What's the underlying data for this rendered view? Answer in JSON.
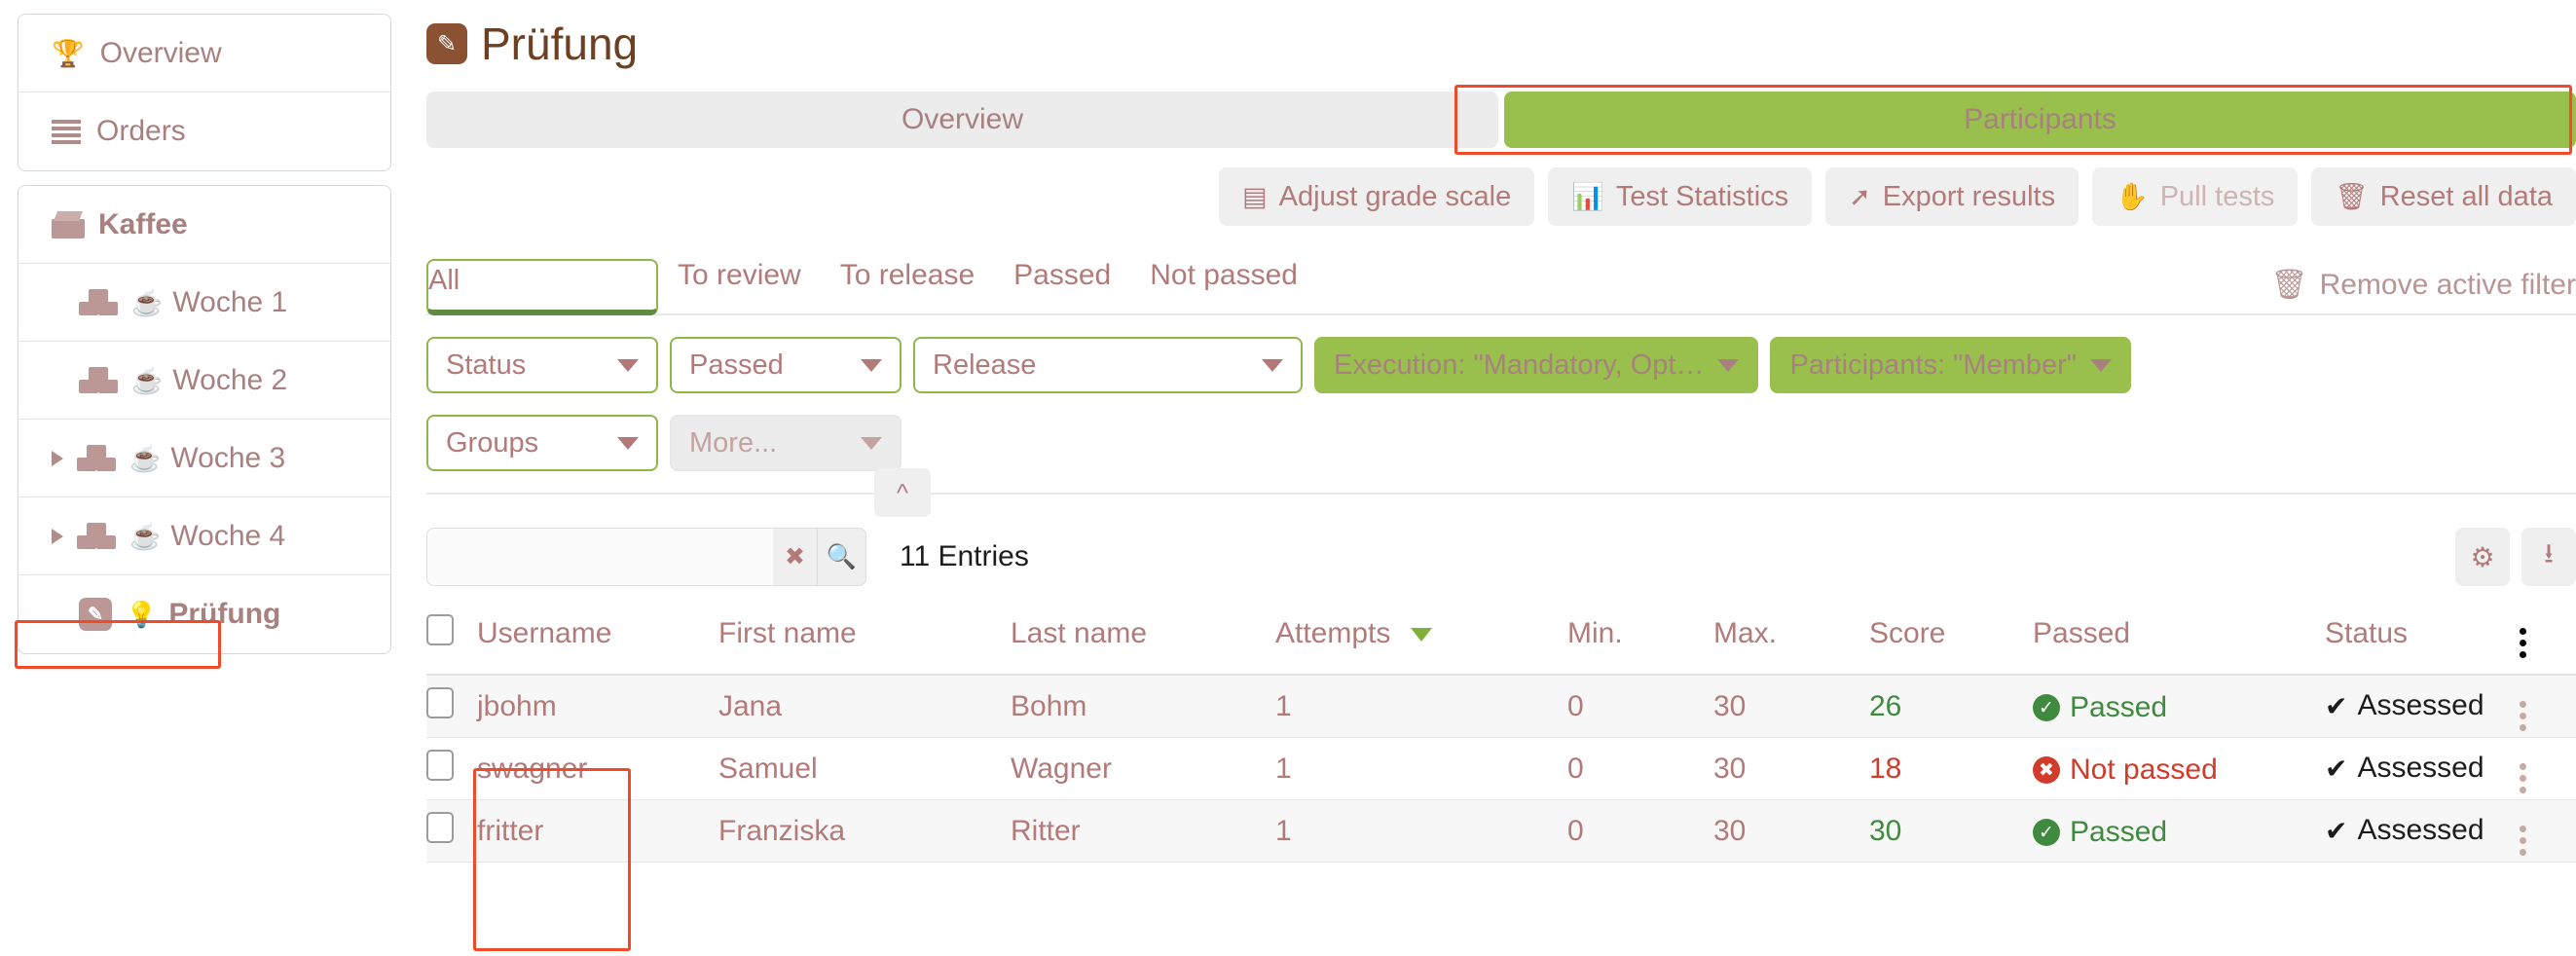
{
  "sidebar": {
    "group1": [
      {
        "label": "Overview",
        "icon": "trophy-icon"
      },
      {
        "label": "Orders",
        "icon": "list-icon"
      }
    ],
    "course": {
      "label": "Kaffee",
      "icon": "box-icon"
    },
    "items": [
      {
        "label": "Woche 1",
        "icon": "cubes-icon",
        "emoji": "☕",
        "expandable": false,
        "active": false
      },
      {
        "label": "Woche 2",
        "icon": "cubes-icon",
        "emoji": "☕",
        "expandable": false,
        "active": false
      },
      {
        "label": "Woche 3",
        "icon": "cubes-icon",
        "emoji": "☕",
        "expandable": true,
        "active": false
      },
      {
        "label": "Woche 4",
        "icon": "cubes-icon",
        "emoji": "☕",
        "expandable": true,
        "active": false
      },
      {
        "label": "Prüfung",
        "icon": "pencil-icon",
        "emoji": "💡",
        "expandable": false,
        "active": true
      }
    ]
  },
  "header": {
    "title": "Prüfung",
    "title_icon": "pencil-icon"
  },
  "tabs": [
    {
      "label": "Overview",
      "active": false
    },
    {
      "label": "Participants",
      "active": true
    }
  ],
  "toolbar": [
    {
      "label": "Adjust grade scale",
      "icon": "calculator-icon",
      "muted": false
    },
    {
      "label": "Test Statistics",
      "icon": "bar-chart-icon",
      "muted": false
    },
    {
      "label": "Export results",
      "icon": "share-icon",
      "muted": false
    },
    {
      "label": "Pull tests",
      "icon": "hand-icon",
      "muted": true
    },
    {
      "label": "Reset all data",
      "icon": "trash-icon",
      "muted": false
    }
  ],
  "filter_tabs": [
    {
      "label": "All",
      "selected": true
    },
    {
      "label": "To review",
      "selected": false
    },
    {
      "label": "To release",
      "selected": false
    },
    {
      "label": "Passed",
      "selected": false
    },
    {
      "label": "Not passed",
      "selected": false
    }
  ],
  "remove_filter": {
    "label": "Remove active filter",
    "icon": "trash-icon"
  },
  "selects_row1": [
    {
      "label": "Status",
      "style": "outline"
    },
    {
      "label": "Passed",
      "style": "outline"
    },
    {
      "label": "Release",
      "style": "outline",
      "wide": true
    },
    {
      "label": "Execution: \"Mandatory, Opt…",
      "style": "active"
    },
    {
      "label": "Participants: \"Member\"",
      "style": "active"
    }
  ],
  "selects_row2": [
    {
      "label": "Groups",
      "style": "outline"
    },
    {
      "label": "More...",
      "style": "gray"
    }
  ],
  "collapse_button": {
    "icon": "chevron-up-icon"
  },
  "search": {
    "value": "",
    "placeholder": "",
    "clear_icon": "clear-circle-icon",
    "search_icon": "magnifier-icon"
  },
  "entries_count": "11 Entries",
  "right_icons": [
    {
      "icon": "gear-icon"
    },
    {
      "icon": "download-icon"
    }
  ],
  "table": {
    "columns": [
      {
        "label": "Username",
        "sorted": false
      },
      {
        "label": "First name",
        "sorted": false
      },
      {
        "label": "Last name",
        "sorted": false
      },
      {
        "label": "Attempts",
        "sorted": true,
        "dir": "desc"
      },
      {
        "label": "Min.",
        "sorted": false
      },
      {
        "label": "Max.",
        "sorted": false
      },
      {
        "label": "Score",
        "sorted": false
      },
      {
        "label": "Passed",
        "sorted": false
      },
      {
        "label": "Status",
        "sorted": false
      }
    ],
    "rows": [
      {
        "username": "jbohm",
        "first_name": "Jana",
        "last_name": "Bohm",
        "attempts": "1",
        "min": "0",
        "max": "30",
        "score": "26",
        "passed": "Passed",
        "passed_state": "ok",
        "status": "Assessed"
      },
      {
        "username": "swagner",
        "first_name": "Samuel",
        "last_name": "Wagner",
        "attempts": "1",
        "min": "0",
        "max": "30",
        "score": "18",
        "passed": "Not passed",
        "passed_state": "bad",
        "status": "Assessed"
      },
      {
        "username": "fritter",
        "first_name": "Franziska",
        "last_name": "Ritter",
        "attempts": "1",
        "min": "0",
        "max": "30",
        "score": "30",
        "passed": "Passed",
        "passed_state": "ok",
        "status": "Assessed"
      }
    ]
  },
  "colors": {
    "accent_green": "#99c04c",
    "annotation_red": "#f04a29",
    "text_mauve": "#b27b7a",
    "title_brown": "#6d4024",
    "pass_green": "#3f8a3f",
    "fail_red": "#d23b2a"
  }
}
